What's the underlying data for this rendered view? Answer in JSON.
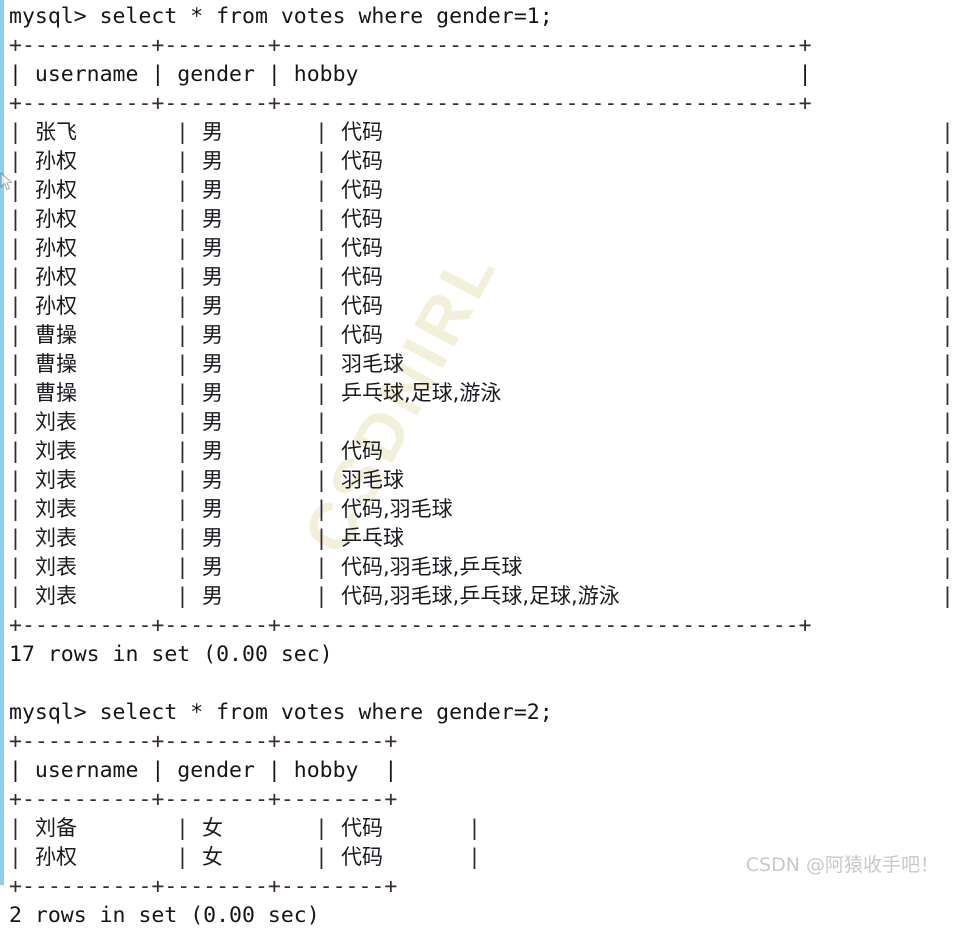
{
  "terminal": {
    "prompt": "mysql> ",
    "accent_color": "#8fcdea",
    "text_color": "#15151a",
    "background_color": "#ffffff"
  },
  "blocks": [
    {
      "command": "mysql> select * from votes where gender=1;",
      "rule": "+----------+--------+----------------------------------------+",
      "columns": [
        "username",
        "gender",
        "hobby"
      ],
      "header_line": "| username | gender | hobby                                  |",
      "rows": [
        {
          "username": "张飞",
          "gender": "男",
          "hobby": "代码"
        },
        {
          "username": "孙权",
          "gender": "男",
          "hobby": "代码"
        },
        {
          "username": "孙权",
          "gender": "男",
          "hobby": "代码"
        },
        {
          "username": "孙权",
          "gender": "男",
          "hobby": "代码"
        },
        {
          "username": "孙权",
          "gender": "男",
          "hobby": "代码"
        },
        {
          "username": "孙权",
          "gender": "男",
          "hobby": "代码"
        },
        {
          "username": "孙权",
          "gender": "男",
          "hobby": "代码"
        },
        {
          "username": "曹操",
          "gender": "男",
          "hobby": "代码"
        },
        {
          "username": "曹操",
          "gender": "男",
          "hobby": "羽毛球"
        },
        {
          "username": "曹操",
          "gender": "男",
          "hobby": "乒乓球,足球,游泳"
        },
        {
          "username": "刘表",
          "gender": "男",
          "hobby": ""
        },
        {
          "username": "刘表",
          "gender": "男",
          "hobby": "代码"
        },
        {
          "username": "刘表",
          "gender": "男",
          "hobby": "羽毛球"
        },
        {
          "username": "刘表",
          "gender": "男",
          "hobby": "代码,羽毛球"
        },
        {
          "username": "刘表",
          "gender": "男",
          "hobby": "乒乓球"
        },
        {
          "username": "刘表",
          "gender": "男",
          "hobby": "代码,羽毛球,乒乓球"
        },
        {
          "username": "刘表",
          "gender": "男",
          "hobby": "代码,羽毛球,乒乓球,足球,游泳"
        }
      ],
      "result": "17 rows in set (0.00 sec)"
    },
    {
      "command": "mysql> select * from votes where gender=2;",
      "rule": "+----------+--------+--------+",
      "columns": [
        "username",
        "gender",
        "hobby"
      ],
      "header_line": "| username | gender | hobby  |",
      "rows": [
        {
          "username": "刘备",
          "gender": "女",
          "hobby": "代码"
        },
        {
          "username": "孙权",
          "gender": "女",
          "hobby": "代码"
        }
      ],
      "result": "2 rows in set (0.00 sec)"
    }
  ],
  "watermarks": {
    "corner": "CSDN @阿猿收手吧！",
    "diagonal": "CSDNIRL"
  }
}
